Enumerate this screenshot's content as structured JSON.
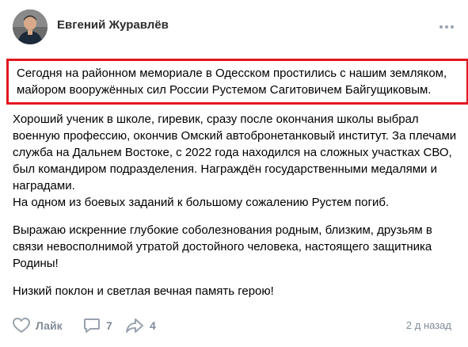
{
  "post": {
    "author": "Евгений Журавлёв",
    "highlighted_text": "Сегодня на районном мемориале в Одесском простились с нашим земляком, майором вооружённых сил России Рустемом Сагитовичем Байгущиковым.",
    "paragraph_2_a": "Хороший ученик в школе, гиревик, сразу после окончания школы выбрал военную профессию, окончив Омский автобронетанковый институт. За плечами служба на Дальнем Востоке, с 2022 года находился на сложных участках СВО, был командиром подразделения. Награждён государственными медалями и наградами.",
    "paragraph_2_b": "На одном из боевых заданий к большому сожалению Рустем погиб.",
    "paragraph_3": "Выражаю искренние глубокие соболезнования родным, близким, друзьям в связи невосполнимой утратой достойного человека, настоящего защитника Родины!",
    "paragraph_4": "Низкий поклон и светлая вечная память герою!"
  },
  "footer": {
    "like_label": "Лайк",
    "comments_count": "7",
    "shares_count": "4",
    "timestamp": "2 д назад"
  },
  "colors": {
    "highlight_border": "#e4161f",
    "meta_gray": "#818c99"
  }
}
